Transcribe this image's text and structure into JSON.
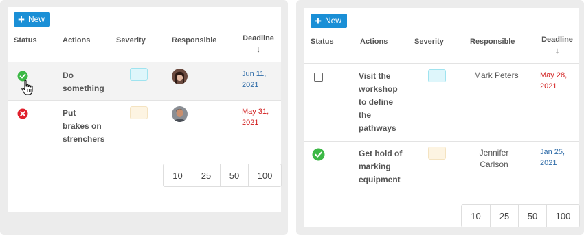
{
  "columns": {
    "status": "Status",
    "actions": "Actions",
    "severity": "Severity",
    "responsible": "Responsible",
    "deadline": "Deadline"
  },
  "new_label": "New",
  "sort_arrow": "↓",
  "left": {
    "rows": [
      {
        "status": "done-hovered",
        "action_lines": [
          "Do",
          "something"
        ],
        "severity": "cyan",
        "avatar": "woman-avatar",
        "date_lines": [
          "Jun 11,",
          "2021"
        ],
        "date_color": "#2f6ca8"
      },
      {
        "status": "failed",
        "action_lines": [
          "Put",
          "brakes on",
          "strenchers"
        ],
        "severity": "cream",
        "avatar": "man-avatar",
        "date_lines": [
          "May 31,",
          "2021"
        ],
        "date_color": "#d11a1a"
      }
    ]
  },
  "right": {
    "rows": [
      {
        "status": "unchecked",
        "action_lines": [
          "Visit the",
          "workshop",
          "to define",
          "the",
          "pathways"
        ],
        "severity": "cyan",
        "responsible_lines": [
          "Mark Peters"
        ],
        "date_lines": [
          "May 28,",
          "2021"
        ],
        "date_color": "#d11a1a"
      },
      {
        "status": "done",
        "action_lines": [
          "Get hold of",
          "marking",
          "equipment"
        ],
        "severity": "cream",
        "responsible_lines": [
          "Jennifer",
          "Carlson"
        ],
        "date_lines": [
          "Jan 25,",
          "2021"
        ],
        "date_color": "#2f6ca8"
      }
    ]
  },
  "page_sizes": [
    "10",
    "25",
    "50",
    "100"
  ],
  "colors": {
    "accent": "#1a8fd6",
    "done_green": "#3cb846",
    "error_red": "#e0202c",
    "severity_cyan": "#def6fb",
    "severity_cream": "#fdf4e2"
  }
}
